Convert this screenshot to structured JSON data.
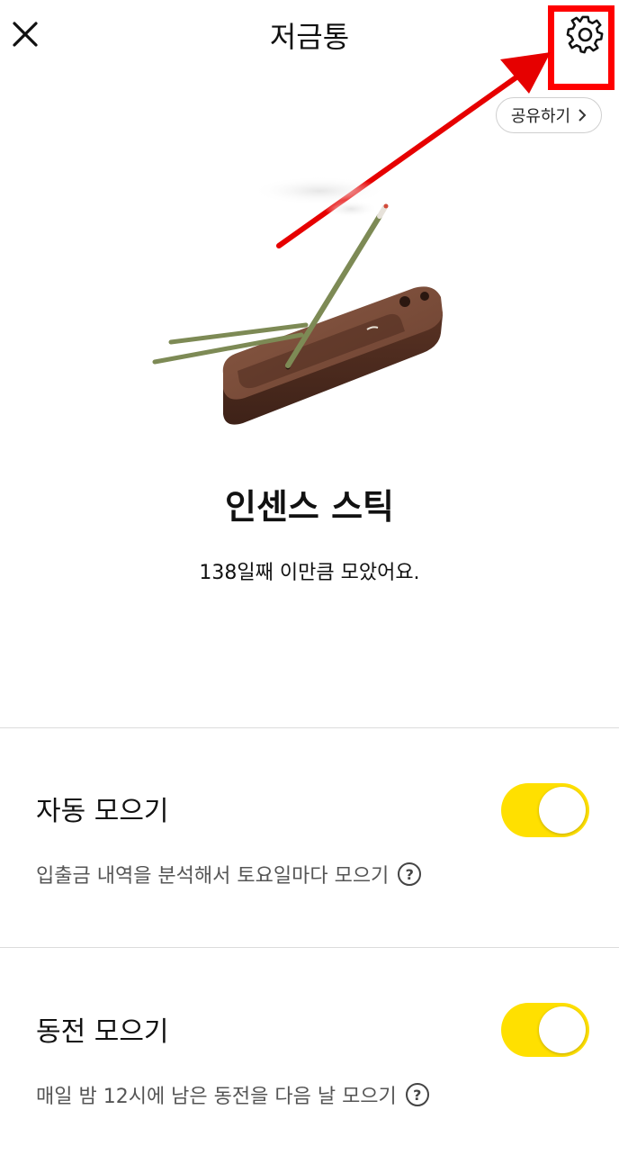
{
  "header": {
    "title": "저금통"
  },
  "share": {
    "label": "공유하기"
  },
  "item": {
    "name": "인센스 스틱",
    "description": "138일째 이만큼 모았어요."
  },
  "settings": [
    {
      "title": "자동 모으기",
      "subtitle": "입출금 내역을 분석해서 토요일마다 모으기",
      "enabled": true
    },
    {
      "title": "동전 모으기",
      "subtitle": "매일 밤 12시에 남은 동전을 다음 날 모으기",
      "enabled": true
    }
  ],
  "icons": {
    "close": "close-icon",
    "settings": "gear-icon",
    "share_chevron": "chevron-right-icon",
    "help": "question-icon"
  },
  "colors": {
    "toggle_on": "#ffe000",
    "annotation": "#ff0000"
  }
}
